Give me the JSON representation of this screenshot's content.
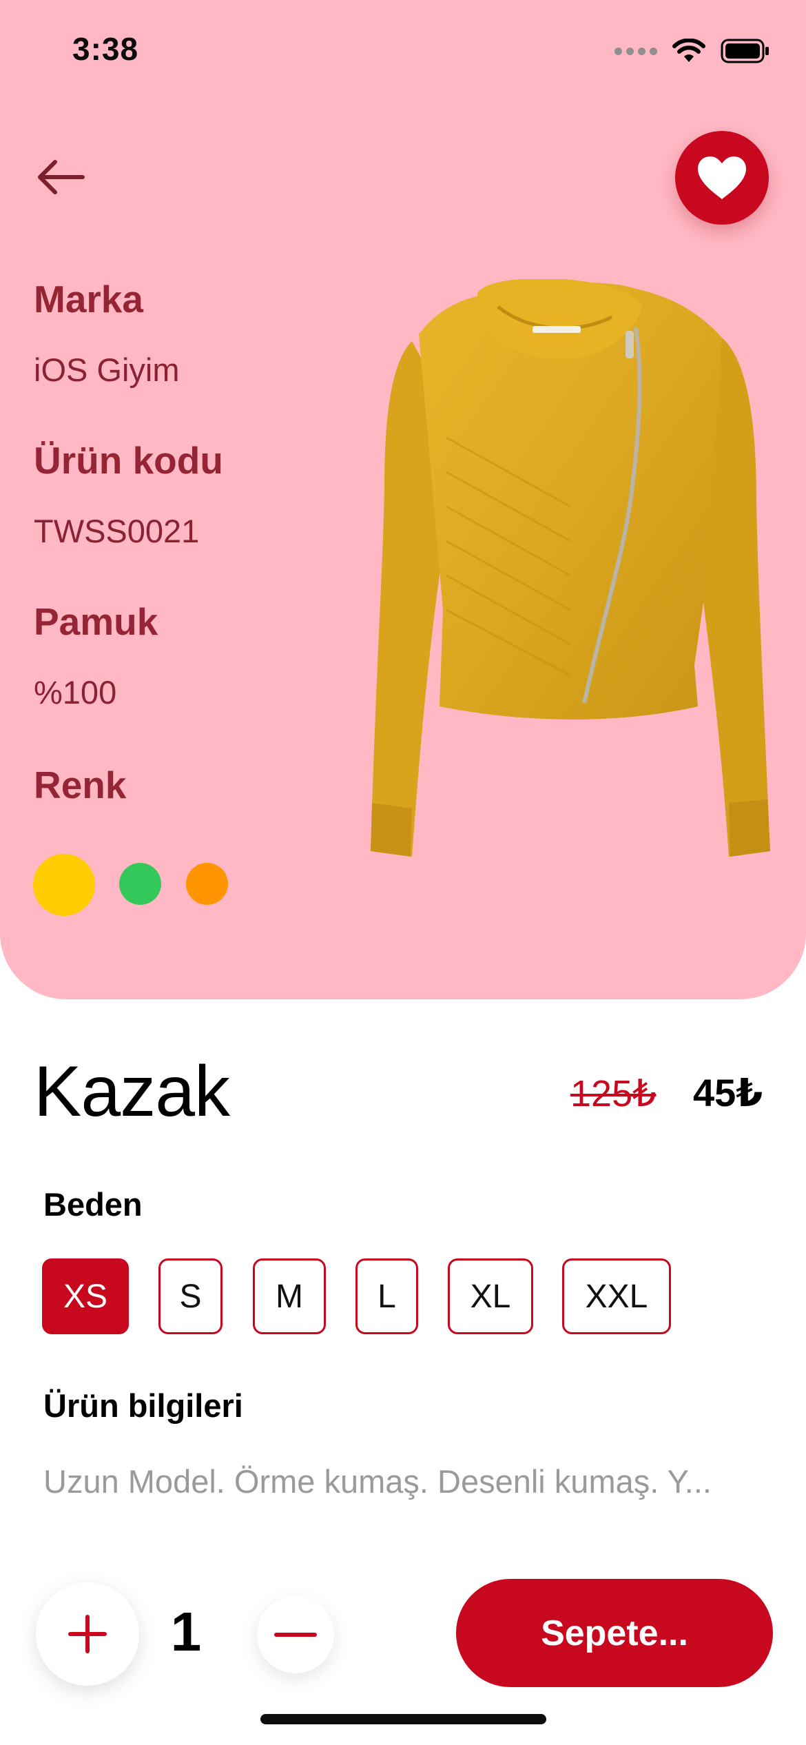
{
  "status_bar": {
    "time": "3:38"
  },
  "nav": {
    "back_icon": "arrow-left-icon",
    "favorite_icon": "heart-icon"
  },
  "attributes": [
    {
      "label": "Marka",
      "value": "iOS Giyim"
    },
    {
      "label": "Ürün kodu",
      "value": "TWSS0021"
    },
    {
      "label": "Pamuk",
      "value": "%100"
    }
  ],
  "color_section": {
    "label": "Renk",
    "swatches": [
      {
        "name": "yellow",
        "color": "#ffcc00",
        "selected": true
      },
      {
        "name": "green",
        "color": "#34c759",
        "selected": false
      },
      {
        "name": "orange",
        "color": "#ff9500",
        "selected": false
      }
    ]
  },
  "product": {
    "title": "Kazak",
    "old_price": "125₺",
    "price": "45₺"
  },
  "sizes": {
    "heading": "Beden",
    "options": [
      "XS",
      "S",
      "M",
      "L",
      "XL",
      "XXL"
    ],
    "selected": "XS"
  },
  "info": {
    "heading": "Ürün bilgileri",
    "text": "Uzun Model. Örme kumaş. Desenli kumaş. Y..."
  },
  "cart": {
    "quantity": "1",
    "plus_icon": "plus-icon",
    "minus_icon": "minus-icon",
    "button_label": "Sepete..."
  },
  "colors": {
    "hero_background": "#ffb8c4",
    "accent": "#c8081e",
    "label_color": "#952535"
  }
}
